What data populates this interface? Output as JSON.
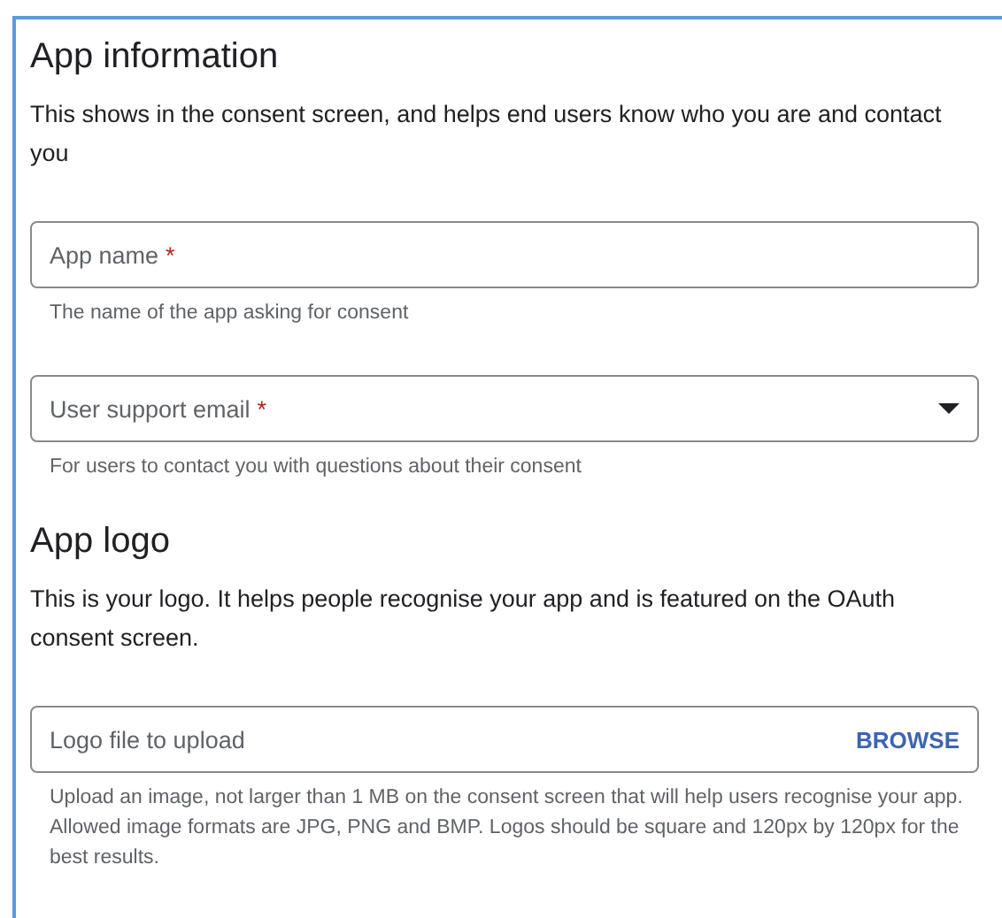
{
  "sections": [
    {
      "heading": "App information",
      "description": "This shows in the consent screen, and helps end users know who you are and contact you",
      "fields": [
        {
          "kind": "text",
          "label": "App name",
          "required_marker": "*",
          "helper": "The name of the app asking for consent"
        },
        {
          "kind": "dropdown",
          "label": "User support email",
          "required_marker": "*",
          "helper": "For users to contact you with questions about their consent"
        }
      ]
    },
    {
      "heading": "App logo",
      "description": "This is your logo. It helps people recognise your app and is featured on the OAuth consent screen.",
      "fields": [
        {
          "kind": "file",
          "label": "Logo file to upload",
          "action": "BROWSE",
          "helper": "Upload an image, not larger than 1 MB on the consent screen that will help users recognise your app. Allowed image formats are JPG, PNG and BMP. Logos should be square and 120px by 120px for the best results."
        }
      ]
    }
  ]
}
